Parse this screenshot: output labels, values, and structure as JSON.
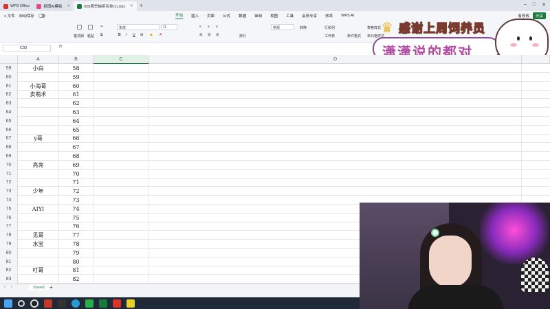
{
  "titlebar": {
    "tabs": [
      {
        "label": "WPS Office",
        "color": "#d9342b"
      },
      {
        "label": "抠图AI模板",
        "color": "#e04a8a"
      },
      {
        "label": "928周举抽奖名单(1).xlsx",
        "color": "#1a7a3c"
      }
    ]
  },
  "menubar": {
    "file": "≡ 文件",
    "autosave": "自动保存",
    "tabs": [
      "开始",
      "插入",
      "页面",
      "公式",
      "数据",
      "审阅",
      "视图",
      "工具",
      "会员专享",
      "效率",
      "WPS AI"
    ],
    "active_tab": "开始",
    "right": {
      "cloud": "有修改",
      "share": "分享"
    }
  },
  "ribbon": {
    "format_painter": "格式刷",
    "paste": "粘贴",
    "font_name": "宋体",
    "font_size": "11",
    "number_format": "常规",
    "convert": "转换",
    "wrap": "换行",
    "insert_row_col": "行和列",
    "worksheet": "工作表",
    "cond_format": "条件格式",
    "cell_style": "单元格样式",
    "table_style": "表格样式"
  },
  "banner": {
    "top_text": "感谢上周饲养员",
    "bottom_text": "潇潇说的都对"
  },
  "formula_bar": {
    "name_box": "C33",
    "fx": "fx"
  },
  "columns": [
    {
      "label": "A",
      "selected": false
    },
    {
      "label": "B",
      "selected": false
    },
    {
      "label": "C",
      "selected": true
    },
    {
      "label": "D",
      "selected": false
    }
  ],
  "rows": [
    {
      "n": "59",
      "a": "小白",
      "b": "58"
    },
    {
      "n": "60",
      "a": "",
      "b": "59"
    },
    {
      "n": "61",
      "a": "小海哥",
      "b": "60"
    },
    {
      "n": "62",
      "a": "卖萌术",
      "b": "61"
    },
    {
      "n": "63",
      "a": "",
      "b": "62"
    },
    {
      "n": "64",
      "a": "",
      "b": "63"
    },
    {
      "n": "65",
      "a": "",
      "b": "64"
    },
    {
      "n": "66",
      "a": "",
      "b": "65"
    },
    {
      "n": "67",
      "a": "y哥",
      "b": "66"
    },
    {
      "n": "68",
      "a": "",
      "b": "67"
    },
    {
      "n": "69",
      "a": "",
      "b": "68"
    },
    {
      "n": "70",
      "a": "亮亮",
      "b": "69"
    },
    {
      "n": "71",
      "a": "",
      "b": "70"
    },
    {
      "n": "72",
      "a": "",
      "b": "71"
    },
    {
      "n": "73",
      "a": "少年",
      "b": "72"
    },
    {
      "n": "74",
      "a": "",
      "b": "73"
    },
    {
      "n": "75",
      "a": "AIYI",
      "b": "74"
    },
    {
      "n": "76",
      "a": "",
      "b": "75"
    },
    {
      "n": "77",
      "a": "",
      "b": "76"
    },
    {
      "n": "78",
      "a": "见哥",
      "b": "77"
    },
    {
      "n": "79",
      "a": "水宝",
      "b": "78"
    },
    {
      "n": "80",
      "a": "",
      "b": "79"
    },
    {
      "n": "81",
      "a": "",
      "b": "80"
    },
    {
      "n": "82",
      "a": "叮哥",
      "b": "81"
    },
    {
      "n": "83",
      "a": "",
      "b": "82"
    }
  ],
  "sheets": [
    "Sheet1"
  ],
  "taskbar_icons": [
    "windows-icon",
    "search-icon",
    "obs-icon",
    "game-icon",
    "terminal-icon",
    "edge-icon",
    "wechat-icon",
    "spreadsheet-icon",
    "wps-icon",
    "chat-icon"
  ]
}
